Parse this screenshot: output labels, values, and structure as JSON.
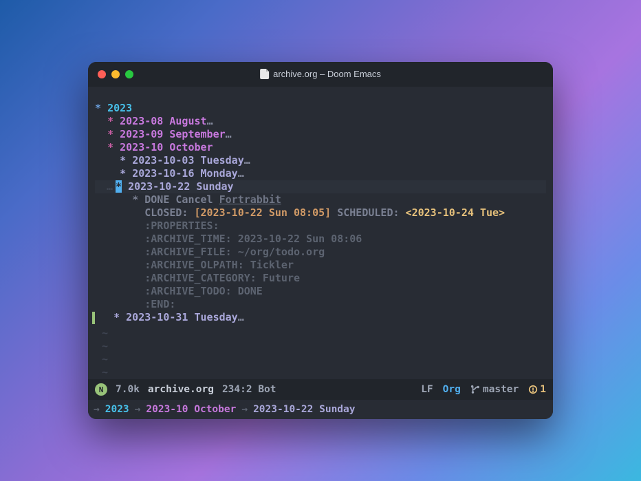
{
  "titlebar": {
    "title": "archive.org – Doom Emacs"
  },
  "org": {
    "year": "2023",
    "months": [
      {
        "bullet": "*",
        "label": "2023-08 August",
        "collapsed": true
      },
      {
        "bullet": "*",
        "label": "2023-09 September",
        "collapsed": true
      },
      {
        "bullet": "*",
        "label": "2023-10 October",
        "collapsed": false
      }
    ],
    "days": {
      "d1": "2023-10-03 Tuesday",
      "d2": "2023-10-16 Monday",
      "d3": "2023-10-22 Sunday",
      "d4": "2023-10-31 Tuesday"
    },
    "entry": {
      "todo_state": "DONE",
      "title_text": "Cancel ",
      "title_link": "Fortrabbit",
      "closed_label": "CLOSED: ",
      "closed_ts": "[2023-10-22 Sun 08:05]",
      "scheduled_label": " SCHEDULED: ",
      "scheduled_ts": "<2023-10-24 Tue>",
      "props_begin": ":PROPERTIES:",
      "archive_time_k": ":ARCHIVE_TIME: ",
      "archive_time_v": "2023-10-22 Sun 08:06",
      "archive_file_k": ":ARCHIVE_FILE: ",
      "archive_file_v": "~/org/todo.org",
      "archive_olpath_k": ":ARCHIVE_OLPATH: ",
      "archive_olpath_v": "Tickler",
      "archive_category_k": ":ARCHIVE_CATEGORY: ",
      "archive_category_v": "Future",
      "archive_todo_k": ":ARCHIVE_TODO: ",
      "archive_todo_v": "DONE",
      "props_end": ":END:"
    }
  },
  "modeline": {
    "evil_state": "N",
    "filesize": "7.0k",
    "filename": "archive.org",
    "position": "234:2 Bot",
    "line_ending": "LF",
    "major_mode": "Org",
    "vcs_branch": "master",
    "flycheck": "1"
  },
  "breadcrumbs": {
    "level1": "2023",
    "level2": "2023-10 October",
    "level3": "2023-10-22 Sunday"
  }
}
